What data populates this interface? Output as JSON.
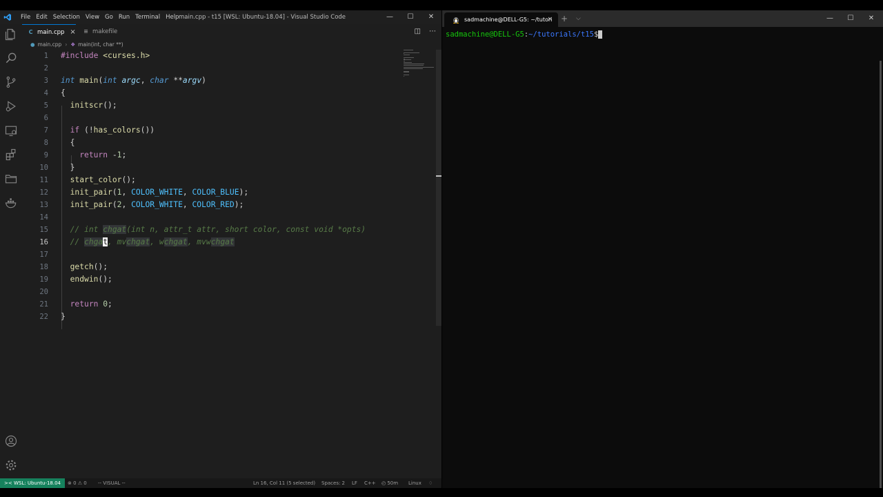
{
  "vscode": {
    "menu": [
      "File",
      "Edit",
      "Selection",
      "View",
      "Go",
      "Run",
      "Terminal",
      "Help"
    ],
    "window_title": "main.cpp - t15 [WSL: Ubuntu-18.04] - Visual Studio Code",
    "window_controls": [
      "minimize-icon",
      "maximize-icon",
      "close-icon"
    ],
    "activity_icons": [
      "explorer-icon",
      "search-icon",
      "source-control-icon",
      "run-debug-icon",
      "remote-explorer-icon",
      "extensions-icon",
      "folder-icon",
      "docker-icon",
      "account-icon",
      "settings-gear-icon"
    ],
    "tabs": [
      {
        "label": "main.cpp",
        "icon": "C",
        "active": true,
        "close": "×"
      },
      {
        "label": "makefile",
        "icon": "≡",
        "active": false
      }
    ],
    "tab_actions": [
      "split-editor-icon",
      "more-actions-icon"
    ],
    "breadcrumb": {
      "file": "main.cpp",
      "symbol": "main(int, char **)"
    },
    "current_line": 16,
    "status": {
      "remote": "WSL: Ubuntu-18.04",
      "problems": "⊗ 0 ⚠ 0",
      "mode": "-- VISUAL --",
      "position": "Ln 16, Col 11 (5 selected)",
      "spaces": "Spaces: 2",
      "eol": "LF",
      "language": "C++",
      "time": "50m",
      "os": "Linux"
    }
  },
  "code": {
    "lines": [
      {
        "n": "1",
        "parts": [
          {
            "t": "#include ",
            "c": "kw-ctl"
          },
          {
            "t": "<curses.h>",
            "c": "inc"
          }
        ]
      },
      {
        "n": "2",
        "parts": []
      },
      {
        "n": "3",
        "parts": [
          {
            "t": "int ",
            "c": "kw"
          },
          {
            "t": "main",
            "c": "fn"
          },
          {
            "t": "(",
            "c": ""
          },
          {
            "t": "int ",
            "c": "kw"
          },
          {
            "t": "argc",
            "c": "param"
          },
          {
            "t": ", ",
            "c": ""
          },
          {
            "t": "char ",
            "c": "kw"
          },
          {
            "t": "**",
            "c": ""
          },
          {
            "t": "argv",
            "c": "param"
          },
          {
            "t": ")",
            "c": ""
          }
        ]
      },
      {
        "n": "4",
        "parts": [
          {
            "t": "{",
            "c": ""
          }
        ]
      },
      {
        "n": "5",
        "parts": [
          {
            "t": "  ",
            "c": ""
          },
          {
            "t": "initscr",
            "c": "fn"
          },
          {
            "t": "();",
            "c": ""
          }
        ]
      },
      {
        "n": "6",
        "parts": []
      },
      {
        "n": "7",
        "parts": [
          {
            "t": "  ",
            "c": ""
          },
          {
            "t": "if",
            "c": "kw-ctl"
          },
          {
            "t": " (!",
            "c": ""
          },
          {
            "t": "has_colors",
            "c": "fn"
          },
          {
            "t": "())",
            "c": ""
          }
        ]
      },
      {
        "n": "8",
        "parts": [
          {
            "t": "  {",
            "c": ""
          }
        ]
      },
      {
        "n": "9",
        "parts": [
          {
            "t": "    ",
            "c": ""
          },
          {
            "t": "return",
            "c": "kw-ctl"
          },
          {
            "t": " -",
            "c": ""
          },
          {
            "t": "1",
            "c": "num"
          },
          {
            "t": ";",
            "c": ""
          }
        ]
      },
      {
        "n": "10",
        "parts": [
          {
            "t": "  }",
            "c": ""
          }
        ]
      },
      {
        "n": "11",
        "parts": [
          {
            "t": "  ",
            "c": ""
          },
          {
            "t": "start_color",
            "c": "fn"
          },
          {
            "t": "();",
            "c": ""
          }
        ]
      },
      {
        "n": "12",
        "parts": [
          {
            "t": "  ",
            "c": ""
          },
          {
            "t": "init_pair",
            "c": "fn"
          },
          {
            "t": "(",
            "c": ""
          },
          {
            "t": "1",
            "c": "num"
          },
          {
            "t": ", ",
            "c": ""
          },
          {
            "t": "COLOR_WHITE",
            "c": "cst"
          },
          {
            "t": ", ",
            "c": ""
          },
          {
            "t": "COLOR_BLUE",
            "c": "cst"
          },
          {
            "t": ");",
            "c": ""
          }
        ]
      },
      {
        "n": "13",
        "parts": [
          {
            "t": "  ",
            "c": ""
          },
          {
            "t": "init_pair",
            "c": "fn"
          },
          {
            "t": "(",
            "c": ""
          },
          {
            "t": "2",
            "c": "num"
          },
          {
            "t": ", ",
            "c": ""
          },
          {
            "t": "COLOR_WHITE",
            "c": "cst"
          },
          {
            "t": ", ",
            "c": ""
          },
          {
            "t": "COLOR_RED",
            "c": "cst"
          },
          {
            "t": ");",
            "c": ""
          }
        ]
      },
      {
        "n": "14",
        "parts": []
      },
      {
        "n": "15",
        "parts": [
          {
            "t": "  ",
            "c": ""
          },
          {
            "t": "// int ",
            "c": "cm"
          },
          {
            "t": "chgat",
            "c": "cm hlw"
          },
          {
            "t": "(int n, attr_t attr, short color, const void *opts)",
            "c": "cm"
          }
        ]
      },
      {
        "n": "16",
        "parts": [
          {
            "t": "  ",
            "c": ""
          },
          {
            "t": "// ",
            "c": "cm"
          },
          {
            "t": "chga",
            "c": "cm hlw"
          },
          {
            "t": "t",
            "c": "cursor"
          },
          {
            "t": ", mv",
            "c": "cm"
          },
          {
            "t": "chgat",
            "c": "cm hlw"
          },
          {
            "t": ", w",
            "c": "cm"
          },
          {
            "t": "chgat",
            "c": "cm hlw"
          },
          {
            "t": ", mvw",
            "c": "cm"
          },
          {
            "t": "chgat",
            "c": "cm hlw"
          }
        ]
      },
      {
        "n": "17",
        "parts": []
      },
      {
        "n": "18",
        "parts": [
          {
            "t": "  ",
            "c": ""
          },
          {
            "t": "getch",
            "c": "fn"
          },
          {
            "t": "();",
            "c": ""
          }
        ]
      },
      {
        "n": "19",
        "parts": [
          {
            "t": "  ",
            "c": ""
          },
          {
            "t": "endwin",
            "c": "fn"
          },
          {
            "t": "();",
            "c": ""
          }
        ]
      },
      {
        "n": "20",
        "parts": []
      },
      {
        "n": "21",
        "parts": [
          {
            "t": "  ",
            "c": ""
          },
          {
            "t": "return",
            "c": "kw-ctl"
          },
          {
            "t": " ",
            "c": ""
          },
          {
            "t": "0",
            "c": "num"
          },
          {
            "t": ";",
            "c": ""
          }
        ]
      },
      {
        "n": "22",
        "parts": [
          {
            "t": "}",
            "c": ""
          }
        ]
      }
    ]
  },
  "terminal": {
    "tab_title": "sadmachine@DELL-G5: ~/tutori",
    "tab_close": "×",
    "new_tab": "+",
    "dropdown": "⌵",
    "prompt_user": "sadmachine@DELL-G5",
    "prompt_sep": ":",
    "prompt_path": "~/tutorials/t15",
    "prompt_symbol": "$"
  }
}
